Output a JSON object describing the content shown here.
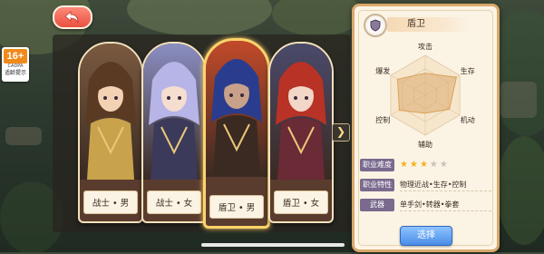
{
  "age_badge": {
    "rating": "16+",
    "org": "CADPA",
    "tip": "适龄提示"
  },
  "cards": [
    {
      "label": "战士 • 男",
      "selected": false,
      "hair": "#5a3a22",
      "skin": "#f3d2b4",
      "robe": "#c9a24c",
      "bg": "#7a5a40"
    },
    {
      "label": "战士 • 女",
      "selected": false,
      "hair": "#b7b4e8",
      "skin": "#f5ddd0",
      "robe": "#3c3a5a",
      "bg": "#8a8fc2"
    },
    {
      "label": "盾卫 • 男",
      "selected": true,
      "hair": "#2a3c8e",
      "skin": "#c9a08a",
      "robe": "#3a2a22",
      "bg": "#c24a2a"
    },
    {
      "label": "盾卫 • 女",
      "selected": false,
      "hair": "#b83226",
      "skin": "#f2d6c8",
      "robe": "#6a2a36",
      "bg": "#4a4a6a"
    }
  ],
  "info": {
    "class_name": "盾卫",
    "radar_axes": [
      "攻击",
      "生存",
      "机动",
      "辅助",
      "控制",
      "爆发"
    ],
    "radar_values": [
      0.55,
      0.9,
      0.7,
      0.45,
      0.75,
      0.8
    ],
    "difficulty_label": "职业难度",
    "difficulty_stars": 3,
    "difficulty_max": 5,
    "trait_label": "职业特性",
    "trait_value": "物理近战•生存•控制",
    "weapon_label": "武器",
    "weapon_value": "单手剑•转器•拳套",
    "select_label": "选择"
  },
  "colors": {
    "accent": "#d9a86a",
    "star_on": "#f2b21c",
    "star_off": "#c7c1b6",
    "attr_tag": "#7a6a8e"
  },
  "icons": {
    "back": "back-arrow-icon",
    "class": "shield-icon",
    "next": "chevron-right-icon",
    "star": "star-icon"
  }
}
